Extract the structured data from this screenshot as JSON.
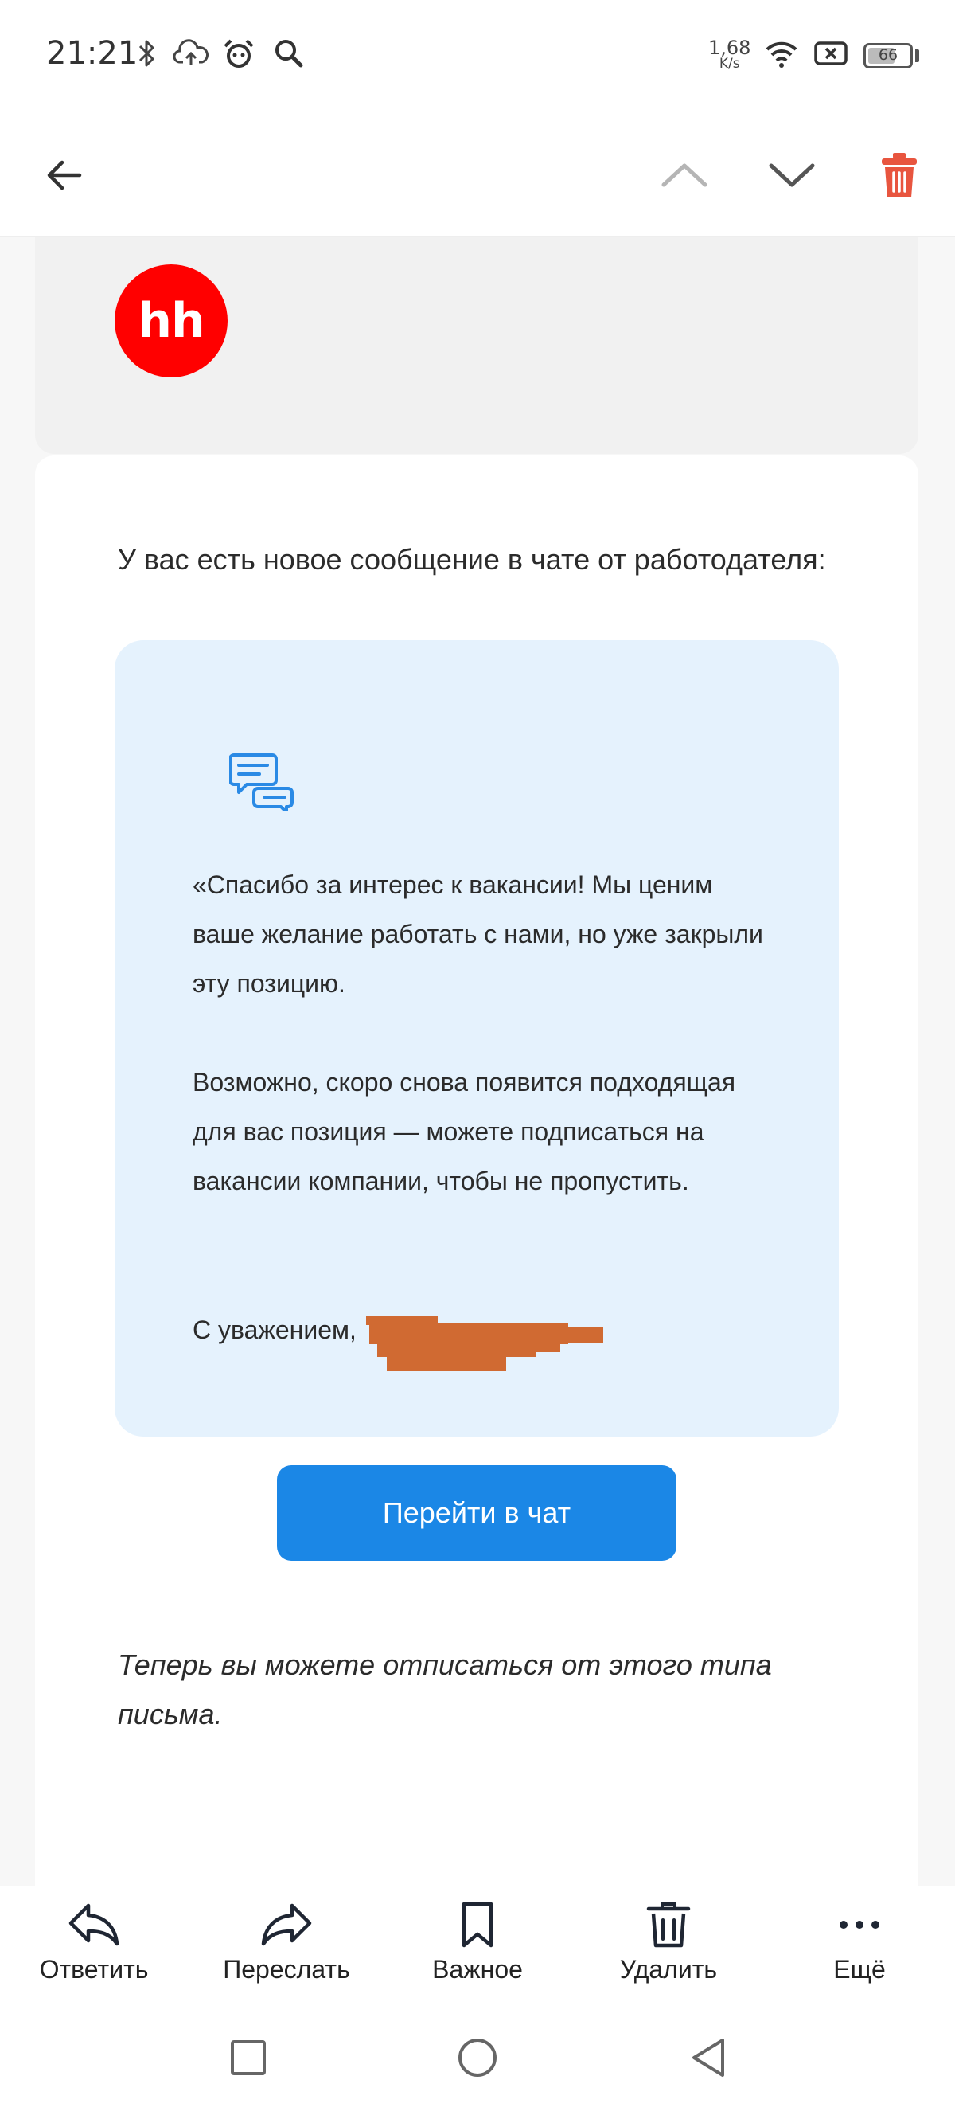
{
  "status_bar": {
    "time": "21:21",
    "net_speed_value": "1,68",
    "net_speed_unit": "K/s",
    "battery_level": "66",
    "battery_fraction": 0.66,
    "icons": [
      "bluetooth-icon",
      "cloud-upload-icon",
      "alarm-icon",
      "search-icon",
      "wifi-icon",
      "sim-off-icon"
    ]
  },
  "toolbar": {
    "icons": [
      "back-arrow-icon",
      "chevron-up-icon",
      "chevron-down-icon",
      "trash-icon"
    ]
  },
  "email": {
    "sender_logo_text": "hh",
    "intro": "У вас есть новое сообщение в чате от работодателя:",
    "message_paragraph_1": "«Спасибо за интерес к вакансии! Мы ценим ваше желание работать с нами, но уже закрыли эту позицию.",
    "message_paragraph_2": "Возможно, скоро снова появится подходящая для вас позиция — можете подписаться на вакансии компании, чтобы не пропустить.",
    "signature": "С уважением,",
    "cta_label": "Перейти в чат",
    "unsubscribe_note": "Теперь вы можете отписаться от этого типа письма."
  },
  "actions": {
    "reply": "Ответить",
    "forward": "Переслать",
    "important": "Важное",
    "delete": "Удалить",
    "more": "Ещё"
  },
  "colors": {
    "brand_red": "#ff0000",
    "accent_blue": "#1b87e6",
    "bubble_bg": "#e5f2fd",
    "delete_red": "#e8553f"
  }
}
